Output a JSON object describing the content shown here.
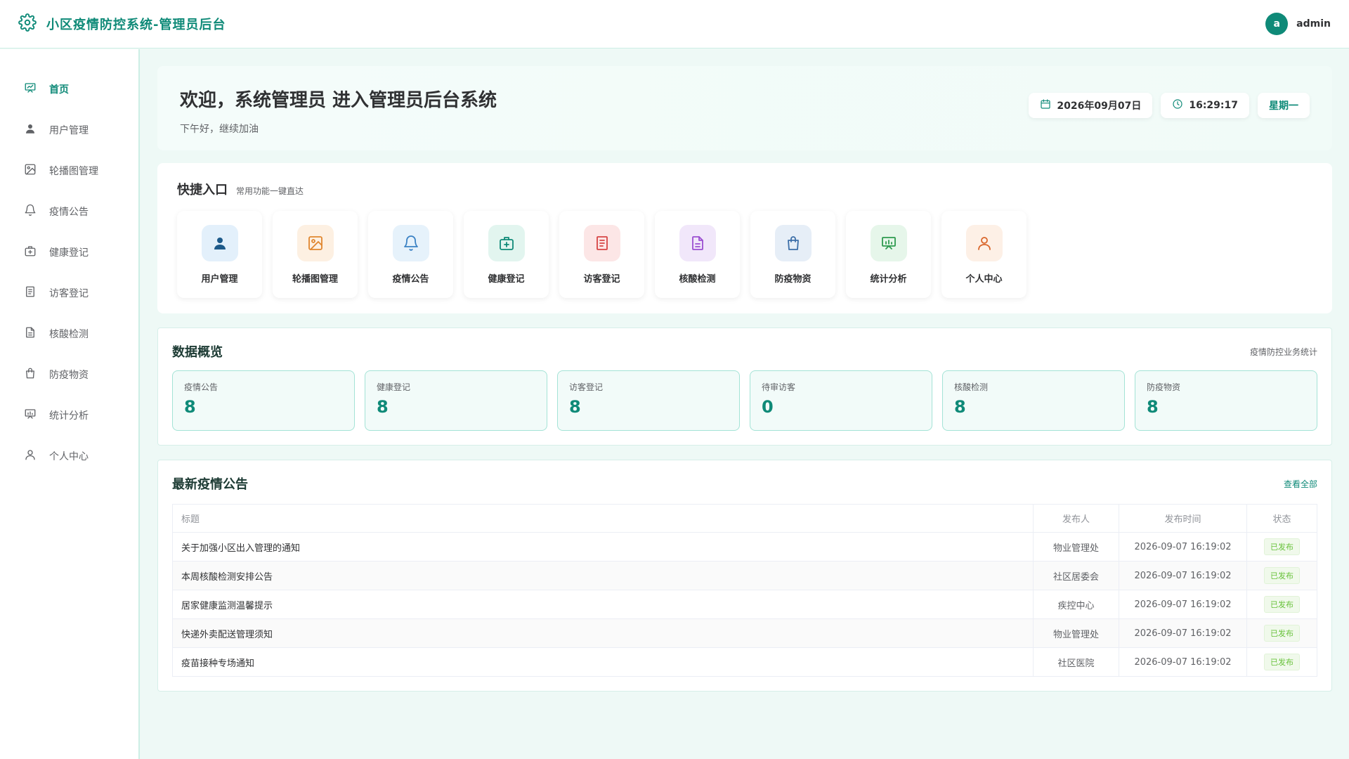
{
  "header": {
    "title": "小区疫情防控系统-管理员后台",
    "avatar_letter": "a",
    "username": "admin"
  },
  "sidebar": {
    "items": [
      {
        "label": "首页",
        "icon": "dashboard-icon",
        "active": true
      },
      {
        "label": "用户管理",
        "icon": "user-icon"
      },
      {
        "label": "轮播图管理",
        "icon": "image-icon"
      },
      {
        "label": "疫情公告",
        "icon": "bell-icon"
      },
      {
        "label": "健康登记",
        "icon": "medical-box-icon"
      },
      {
        "label": "访客登记",
        "icon": "document-icon"
      },
      {
        "label": "核酸检测",
        "icon": "file-icon"
      },
      {
        "label": "防疫物资",
        "icon": "shopping-bag-icon"
      },
      {
        "label": "统计分析",
        "icon": "chart-icon"
      },
      {
        "label": "个人中心",
        "icon": "person-icon"
      }
    ]
  },
  "welcome": {
    "title": "欢迎，系统管理员 进入管理员后台系统",
    "subtitle": "下午好，继续加油",
    "date": "2026年09月07日",
    "time": "16:29:17",
    "weekday": "星期一"
  },
  "quick": {
    "title": "快捷入口",
    "subtitle": "常用功能一键直达",
    "items": [
      {
        "label": "用户管理",
        "icon": "user-icon",
        "bg": "#e3f0fb",
        "color": "#1d5a8a"
      },
      {
        "label": "轮播图管理",
        "icon": "image-icon",
        "bg": "#fdf0e2",
        "color": "#e0862e"
      },
      {
        "label": "疫情公告",
        "icon": "bell-icon",
        "bg": "#e6f2fb",
        "color": "#3b82c4"
      },
      {
        "label": "健康登记",
        "icon": "medical-box-icon",
        "bg": "#e2f5ef",
        "color": "#0f8a78"
      },
      {
        "label": "访客登记",
        "icon": "document-icon",
        "bg": "#fce6e6",
        "color": "#d64545"
      },
      {
        "label": "核酸检测",
        "icon": "file-icon",
        "bg": "#f1e7fa",
        "color": "#9b4fd1"
      },
      {
        "label": "防疫物资",
        "icon": "shopping-bag-icon",
        "bg": "#e6eef7",
        "color": "#3d6fa8"
      },
      {
        "label": "统计分析",
        "icon": "chart-icon",
        "bg": "#e6f6ea",
        "color": "#2e9a4f"
      },
      {
        "label": "个人中心",
        "icon": "person-icon",
        "bg": "#fdf0e6",
        "color": "#d9652a"
      }
    ]
  },
  "overview": {
    "title": "数据概览",
    "link": "疫情防控业务统计",
    "stats": [
      {
        "label": "疫情公告",
        "value": "8"
      },
      {
        "label": "健康登记",
        "value": "8"
      },
      {
        "label": "访客登记",
        "value": "8"
      },
      {
        "label": "待审访客",
        "value": "0"
      },
      {
        "label": "核酸检测",
        "value": "8"
      },
      {
        "label": "防疫物资",
        "value": "8"
      }
    ]
  },
  "notices": {
    "title": "最新疫情公告",
    "link": "查看全部",
    "columns": [
      "标题",
      "发布人",
      "发布时间",
      "状态"
    ],
    "rows": [
      {
        "title": "关于加强小区出入管理的通知",
        "publisher": "物业管理处",
        "time": "2026-09-07 16:19:02",
        "status": "已发布"
      },
      {
        "title": "本周核酸检测安排公告",
        "publisher": "社区居委会",
        "time": "2026-09-07 16:19:02",
        "status": "已发布"
      },
      {
        "title": "居家健康监测温馨提示",
        "publisher": "疾控中心",
        "time": "2026-09-07 16:19:02",
        "status": "已发布"
      },
      {
        "title": "快递外卖配送管理须知",
        "publisher": "物业管理处",
        "time": "2026-09-07 16:19:02",
        "status": "已发布"
      },
      {
        "title": "疫苗接种专场通知",
        "publisher": "社区医院",
        "time": "2026-09-07 16:19:02",
        "status": "已发布"
      }
    ]
  },
  "colors": {
    "primary": "#0f8a78",
    "success": "#67c23a"
  }
}
